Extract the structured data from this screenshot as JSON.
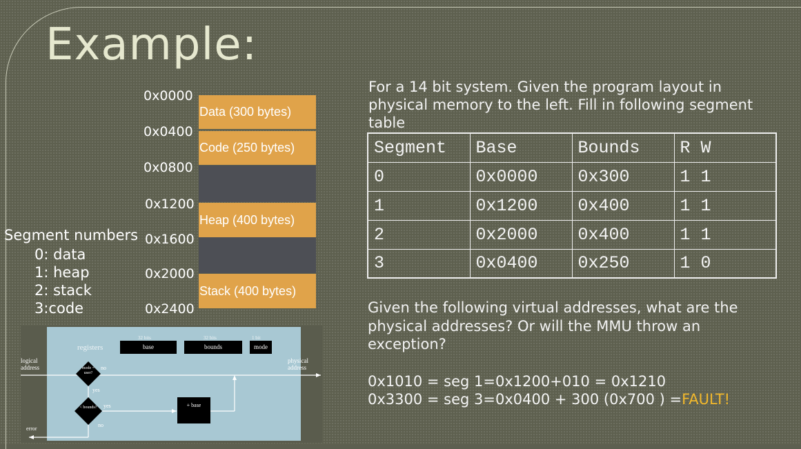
{
  "slide": {
    "title": "Example:"
  },
  "memory": {
    "addresses": [
      "0x0000",
      "0x0400",
      "0x0800",
      "0x1200",
      "0x1600",
      "0x2000",
      "0x2400"
    ],
    "blocks": [
      {
        "label": "Data  (300 bytes)",
        "color": "#e0a34a"
      },
      {
        "label": "Code  (250 bytes)",
        "color": "#e0a34a"
      },
      {
        "label": "",
        "color": "#4d4f55"
      },
      {
        "label": "Heap (400 bytes)",
        "color": "#e0a34a"
      },
      {
        "label": "",
        "color": "#4d4f55"
      },
      {
        "label": "Stack (400 bytes)",
        "color": "#e0a34a"
      }
    ]
  },
  "segments_legend": {
    "heading": "Segment numbers",
    "items": [
      "0: data",
      "1: heap",
      "2: stack",
      "3:code"
    ]
  },
  "intro_text": "For a 14 bit system. Given the program layout in physical memory to the left.  Fill in following segment table",
  "segment_table": {
    "headers": [
      "Segment",
      "Base",
      "Bounds",
      "R W"
    ],
    "rows": [
      [
        "0",
        "0x0000",
        "0x300",
        "1 1"
      ],
      [
        "1",
        "0x1200",
        "0x400",
        "1 1"
      ],
      [
        "2",
        "0x2000",
        "0x400",
        "1 1"
      ],
      [
        "3",
        "0x0400",
        "0x250",
        "1 0"
      ]
    ]
  },
  "question": "Given the following virtual addresses, what are the physical addresses?  Or will the MMU throw an exception?",
  "answers": {
    "line1": "0x1010 = seg 1=0x1200+010 = 0x1210",
    "line2": "0x3300 = seg 3=0x0400 + 300 (0x700 ) =",
    "fault": "FAULT!",
    "fault_color": "#f2b82c"
  },
  "diagram": {
    "registers_label": "registers",
    "reg_bits": [
      "32 bits",
      "32 bits",
      "1 bit"
    ],
    "reg_names": [
      "base",
      "bounds",
      "mode"
    ],
    "logical_address": "logical address",
    "physical_address": "physical address",
    "mode_check": "mode = user?",
    "bounds_check": "< bounds?",
    "yes1": "yes",
    "no1": "no",
    "yes2": "yes",
    "no2": "no",
    "plus_base": "+ base",
    "error": "error"
  }
}
